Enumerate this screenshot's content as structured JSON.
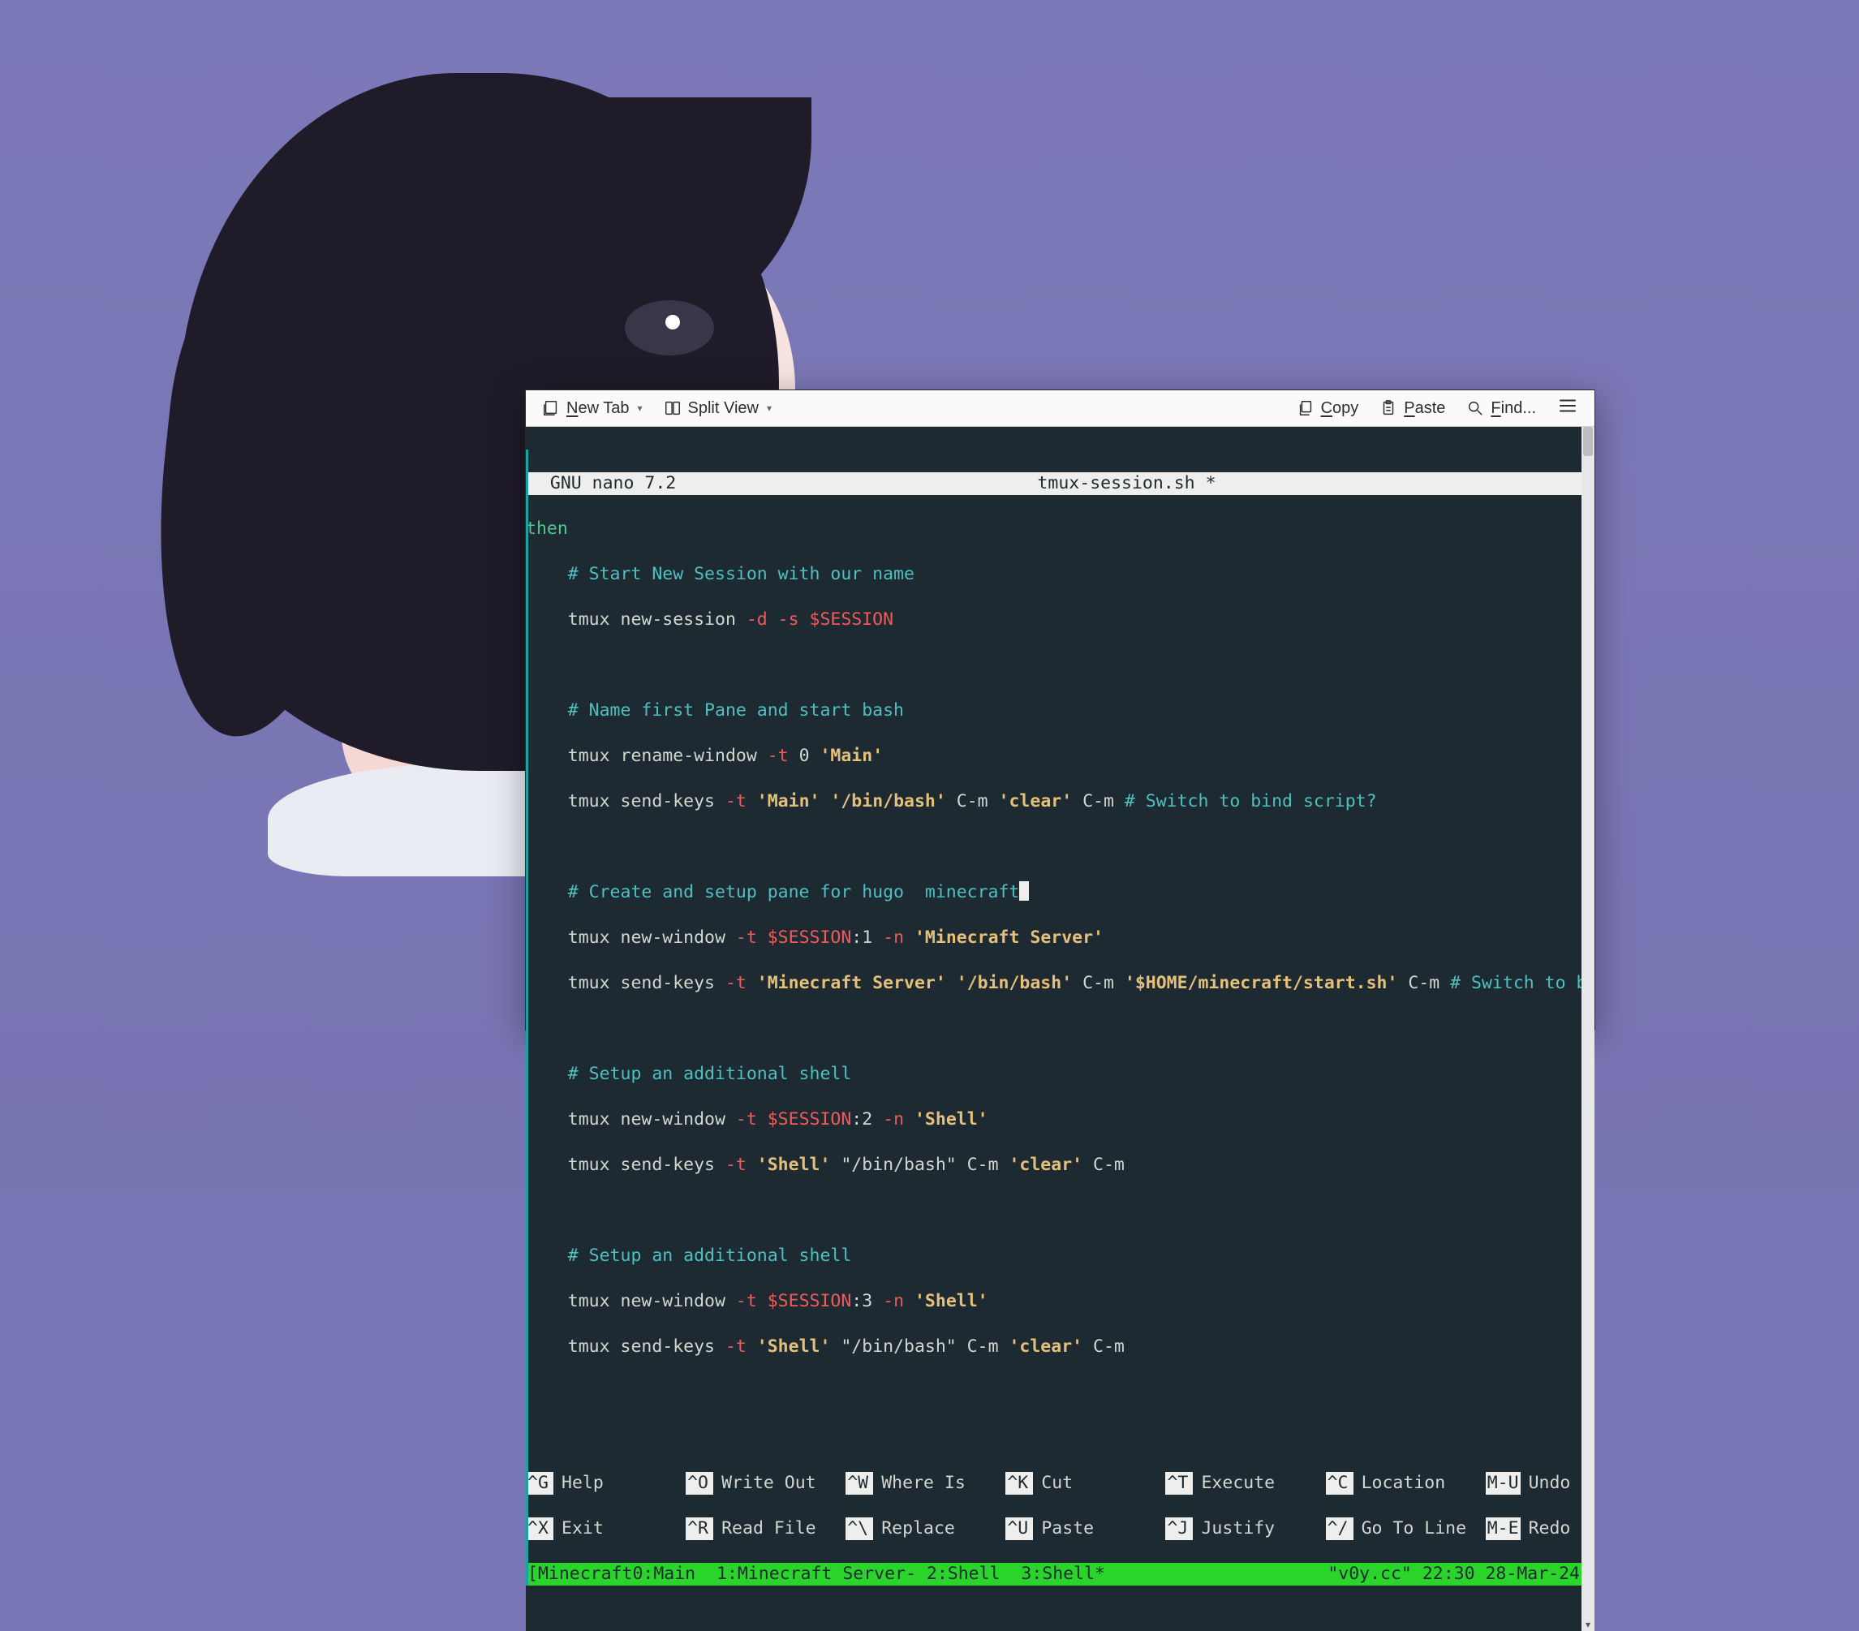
{
  "toolbar": {
    "new_tab": "New Tab",
    "split_view": "Split View",
    "copy": "Copy",
    "paste": "Paste",
    "find": "Find..."
  },
  "nano": {
    "app": "GNU nano 7.2",
    "filename": "tmux-session.sh *"
  },
  "code": {
    "l0": "then",
    "c1": "# Start New Session with our name",
    "l2a": "tmux new-session ",
    "l2b": "-d -s ",
    "l2c": "$SESSION",
    "c3": "# Name first Pane and start bash",
    "l4a": "tmux rename-window ",
    "l4b": "-t ",
    "l4c": "0 ",
    "l4d": "'Main'",
    "l5a": "tmux send-keys ",
    "l5b": "-t ",
    "l5c": "'Main'",
    "l5d": " ",
    "l5e": "'/bin/bash'",
    "l5f": " C-m ",
    "l5g": "'clear'",
    "l5h": " C-m ",
    "l5i": "# Switch to bind script?",
    "c6": "# Create and setup pane for hugo  minecraft",
    "l7a": "tmux new-window ",
    "l7b": "-t ",
    "l7c": "$SESSION",
    "l7d": ":1 ",
    "l7e": "-n ",
    "l7f": "'Minecraft Server'",
    "l8a": "tmux send-keys ",
    "l8b": "-t ",
    "l8c": "'Minecraft Server'",
    "l8d": " ",
    "l8e": "'/bin/bash'",
    "l8f": " C-m ",
    "l8g": "'$HOME/minecraft/start.sh'",
    "l8h": " C-m ",
    "l8i": "# Switch to bind scri",
    "c9": "# Setup an additional shell",
    "l10a": "tmux new-window ",
    "l10b": "-t ",
    "l10c": "$SESSION",
    "l10d": ":2 ",
    "l10e": "-n ",
    "l10f": "'Shell'",
    "l11a": "tmux send-keys ",
    "l11b": "-t ",
    "l11c": "'Shell'",
    "l11d": " \"/bin/bash\" C-m ",
    "l11e": "'clear'",
    "l11f": " C-m",
    "c12": "# Setup an additional shell",
    "l13a": "tmux new-window ",
    "l13b": "-t ",
    "l13c": "$SESSION",
    "l13d": ":3 ",
    "l13e": "-n ",
    "l13f": "'Shell'",
    "l14a": "tmux send-keys ",
    "l14b": "-t ",
    "l14c": "'Shell'",
    "l14d": " \"/bin/bash\" C-m ",
    "l14e": "'clear'",
    "l14f": " C-m"
  },
  "shortcuts": {
    "r1": [
      {
        "k": "^G",
        "l": "Help"
      },
      {
        "k": "^O",
        "l": "Write Out"
      },
      {
        "k": "^W",
        "l": "Where Is"
      },
      {
        "k": "^K",
        "l": "Cut"
      },
      {
        "k": "^T",
        "l": "Execute"
      },
      {
        "k": "^C",
        "l": "Location"
      },
      {
        "k": "M-U",
        "l": "Undo"
      }
    ],
    "r2": [
      {
        "k": "^X",
        "l": "Exit"
      },
      {
        "k": "^R",
        "l": "Read File"
      },
      {
        "k": "^\\",
        "l": "Replace"
      },
      {
        "k": "^U",
        "l": "Paste"
      },
      {
        "k": "^J",
        "l": "Justify"
      },
      {
        "k": "^/",
        "l": "Go To Line"
      },
      {
        "k": "M-E",
        "l": "Redo"
      }
    ]
  },
  "tmux": {
    "left": "[Minecraft0:Main  1:Minecraft Server- 2:Shell  3:Shell*",
    "right": "\"v0y.cc\" 22:30 28-Mar-24"
  }
}
